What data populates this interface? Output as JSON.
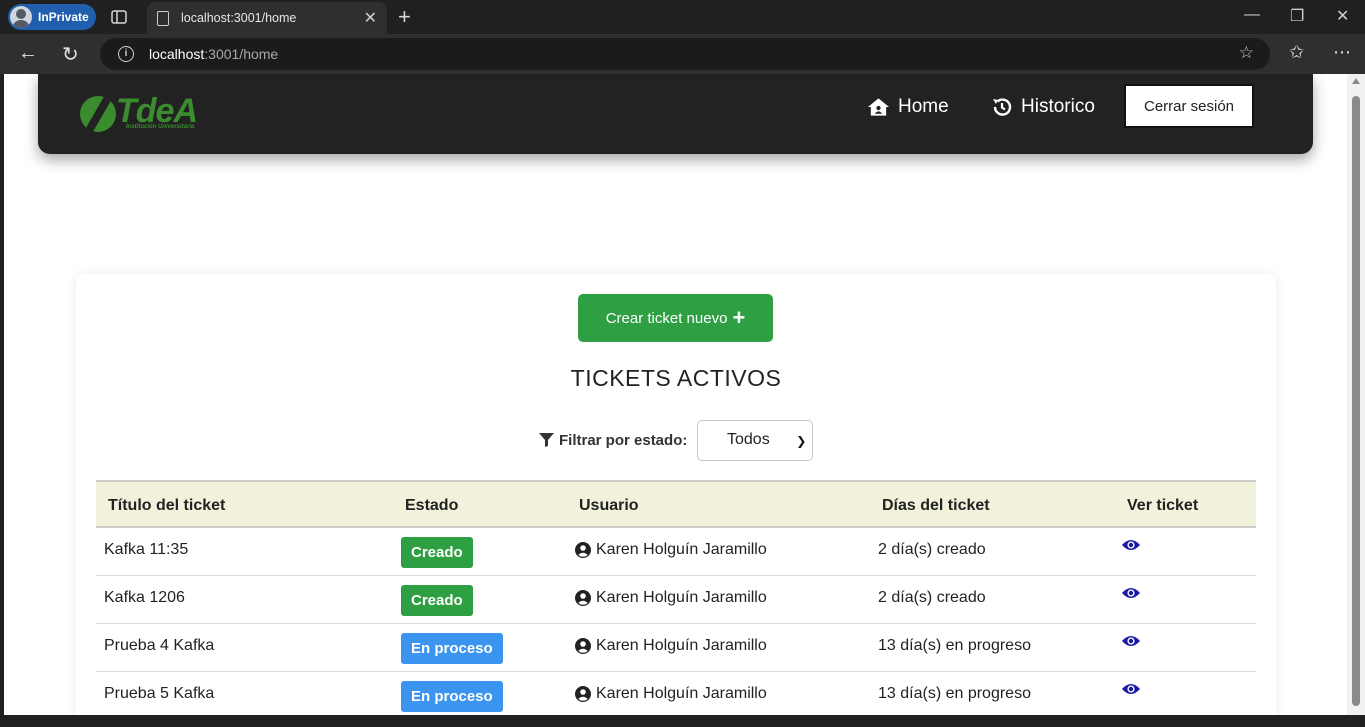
{
  "browser": {
    "inprivate_label": "InPrivate",
    "tab_title": "localhost:3001/home",
    "url_host": "localhost",
    "url_rest": ":3001/home"
  },
  "navbar": {
    "logo_text": "TdeA",
    "logo_subtext": "Institución Universitaria",
    "home_label": "Home",
    "historico_label": "Historico",
    "logout_label": "Cerrar sesión"
  },
  "main": {
    "create_button": "Crear ticket nuevo",
    "create_plus": "+",
    "title": "TICKETS ACTIVOS",
    "filter_label": "Filtrar por estado:",
    "filter_value": "Todos"
  },
  "table": {
    "headers": [
      "Título del ticket",
      "Estado",
      "Usuario",
      "Días del ticket",
      "Ver ticket"
    ],
    "rows": [
      {
        "title": "Kafka 11:35",
        "status": "Creado",
        "user": "Karen Holguín Jaramillo",
        "days": "2 día(s) creado"
      },
      {
        "title": "Kafka 1206",
        "status": "Creado",
        "user": "Karen Holguín Jaramillo",
        "days": "2 día(s) creado"
      },
      {
        "title": "Prueba 4 Kafka",
        "status": "En proceso",
        "user": "Karen Holguín Jaramillo",
        "days": "13 día(s) en progreso"
      },
      {
        "title": "Prueba 5 Kafka",
        "status": "En proceso",
        "user": "Karen Holguín Jaramillo",
        "days": "13 día(s) en progreso"
      }
    ]
  },
  "colors": {
    "creado": "#2ea043",
    "en_proceso": "#3b94ef",
    "eye": "#1a1aa6",
    "header_bg": "#f2f2dc"
  }
}
